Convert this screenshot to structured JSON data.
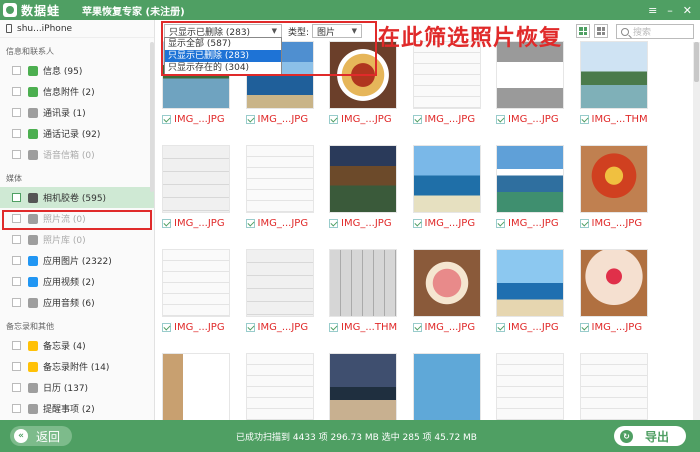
{
  "titlebar": {
    "logo_text": "数据蛙",
    "app_title": "苹果恢复专家 (未注册)",
    "menu_icon": "≡",
    "minimize_icon": "–",
    "close_icon": "✕"
  },
  "sidebar": {
    "device_name": "shu...iPhone",
    "sections": [
      {
        "title": "信息和联系人",
        "items": [
          {
            "label": "信息 (95)",
            "icon_color": "#4caf50",
            "disabled": false
          },
          {
            "label": "信息附件 (2)",
            "icon_color": "#4caf50",
            "disabled": false
          },
          {
            "label": "通讯录 (1)",
            "icon_color": "#9e9e9e",
            "disabled": false
          },
          {
            "label": "通话记录 (92)",
            "icon_color": "#4caf50",
            "disabled": false
          },
          {
            "label": "语音信箱 (0)",
            "icon_color": "#9e9e9e",
            "disabled": true
          }
        ]
      },
      {
        "title": "媒体",
        "items": [
          {
            "label": "相机胶卷 (595)",
            "icon_color": "#555555",
            "disabled": false,
            "active": true
          },
          {
            "label": "照片流 (0)",
            "icon_color": "#9e9e9e",
            "disabled": true
          },
          {
            "label": "照片库 (0)",
            "icon_color": "#9e9e9e",
            "disabled": true
          },
          {
            "label": "应用图片 (2322)",
            "icon_color": "#2196f3",
            "disabled": false
          },
          {
            "label": "应用视频 (2)",
            "icon_color": "#2196f3",
            "disabled": false
          },
          {
            "label": "应用音频 (6)",
            "icon_color": "#9e9e9e",
            "disabled": false
          }
        ]
      },
      {
        "title": "备忘录和其他",
        "items": [
          {
            "label": "备忘录 (4)",
            "icon_color": "#ffc107",
            "disabled": false
          },
          {
            "label": "备忘录附件 (14)",
            "icon_color": "#ffc107",
            "disabled": false
          },
          {
            "label": "日历 (137)",
            "icon_color": "#9e9e9e",
            "disabled": false
          },
          {
            "label": "提醒事项 (2)",
            "icon_color": "#9e9e9e",
            "disabled": false
          }
        ]
      }
    ]
  },
  "toolbar": {
    "filter_selected": "只显示已删除 (283)",
    "filter_options": [
      "显示全部 (587)",
      "只显示已删除 (283)",
      "只显示存在的 (304)"
    ],
    "filter_highlighted_index": 1,
    "type_label": "类型:",
    "type_selected": "图片",
    "search_placeholder": "搜索",
    "annotation": "在此筛选照片恢复"
  },
  "grid": {
    "tiles": [
      {
        "caption": "IMG_...JPG",
        "kind": "lake"
      },
      {
        "caption": "IMG_...JPG",
        "kind": "sea"
      },
      {
        "caption": "IMG_...JPG",
        "kind": "food"
      },
      {
        "caption": "IMG_...JPG",
        "kind": "screen"
      },
      {
        "caption": "IMG_...JPG",
        "kind": "dialog"
      },
      {
        "caption": "IMG_...THM",
        "kind": "karst"
      },
      {
        "caption": "IMG_...JPG",
        "kind": "screen-grey"
      },
      {
        "caption": "IMG_...JPG",
        "kind": "screen"
      },
      {
        "caption": "IMG_...JPG",
        "kind": "village"
      },
      {
        "caption": "IMG_...JPG",
        "kind": "island"
      },
      {
        "caption": "IMG_...JPG",
        "kind": "mountain"
      },
      {
        "caption": "IMG_...JPG",
        "kind": "dish"
      },
      {
        "caption": "IMG_...JPG",
        "kind": "screen"
      },
      {
        "caption": "IMG_...JPG",
        "kind": "screen-grey"
      },
      {
        "caption": "IMG_...THM",
        "kind": "keyboard"
      },
      {
        "caption": "IMG_...JPG",
        "kind": "meat"
      },
      {
        "caption": "IMG_...JPG",
        "kind": "beach"
      },
      {
        "caption": "IMG_...JPG",
        "kind": "cake"
      },
      {
        "caption": "",
        "kind": "book"
      },
      {
        "caption": "",
        "kind": "screen"
      },
      {
        "caption": "",
        "kind": "palm"
      },
      {
        "caption": "",
        "kind": "writing"
      },
      {
        "caption": "",
        "kind": "screen"
      },
      {
        "caption": "",
        "kind": "screen"
      }
    ]
  },
  "bottombar": {
    "back_label": "返回",
    "status": "已成功扫描到 4433 项 296.73 MB 选中 285 项 45.72 MB",
    "export_label": "导出"
  }
}
